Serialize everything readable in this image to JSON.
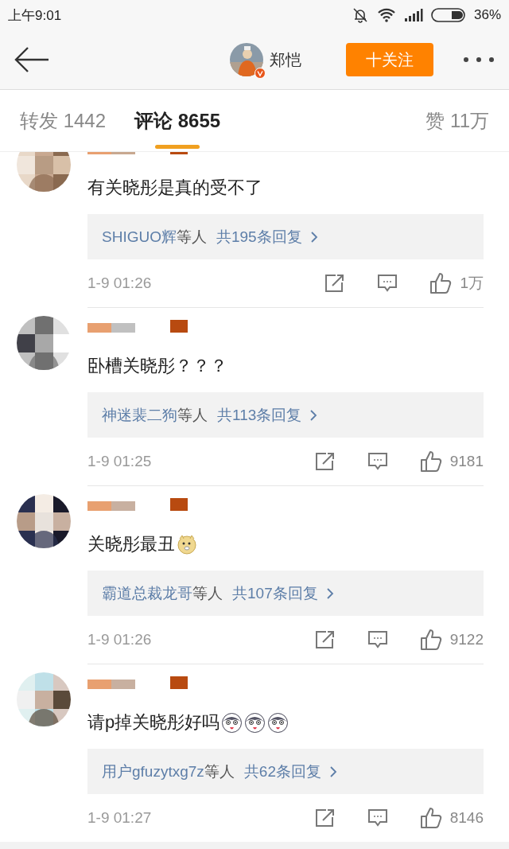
{
  "status_bar": {
    "time": "上午9:01",
    "battery": "36%"
  },
  "header": {
    "avatar": {
      "kind": "picture"
    },
    "verified": true,
    "name": "郑恺",
    "follow_button": "十关注"
  },
  "tabs": [
    {
      "label": "转发",
      "count": "1442",
      "selected": false
    },
    {
      "label": "评论",
      "count": "8655",
      "selected": true
    },
    {
      "label": "赞",
      "count": "11万",
      "selected": false
    }
  ],
  "comments": [
    {
      "avatar": {
        "kind": "picture"
      },
      "name_hidden": true,
      "text": "有关晓彤是真的受不了",
      "replies": {
        "names": "SHIGUO辉",
        "suffix": "等人",
        "total": "共195条回复"
      },
      "time": "1-9 01:26",
      "likes": "1万"
    },
    {
      "avatar": {
        "kind": "picture"
      },
      "name_hidden": true,
      "text": "卧槽关晓彤？？？",
      "replies": {
        "names": "神迷裴二狗",
        "suffix": "等人",
        "total": "共113条回复"
      },
      "time": "1-9 01:25",
      "likes": "9181"
    },
    {
      "avatar": {
        "kind": "picture"
      },
      "name_hidden": true,
      "text": "关晓彤最丑",
      "emojis": [
        {
          "kind": "doge"
        }
      ],
      "replies": {
        "names": "霸道总裁龙哥",
        "suffix": "等人",
        "total": "共107条回复"
      },
      "time": "1-9 01:26",
      "likes": "9122"
    },
    {
      "avatar": {
        "kind": "picture"
      },
      "name_hidden": true,
      "text": "请p掉关晓彤好吗",
      "emojis": [
        {
          "kind": "husky"
        },
        {
          "kind": "husky"
        },
        {
          "kind": "husky"
        }
      ],
      "replies": {
        "names": "用户gfuzytxg7z",
        "suffix": "等人",
        "total": "共62条回复"
      },
      "time": "1-9 01:27",
      "likes": "8146"
    }
  ]
}
